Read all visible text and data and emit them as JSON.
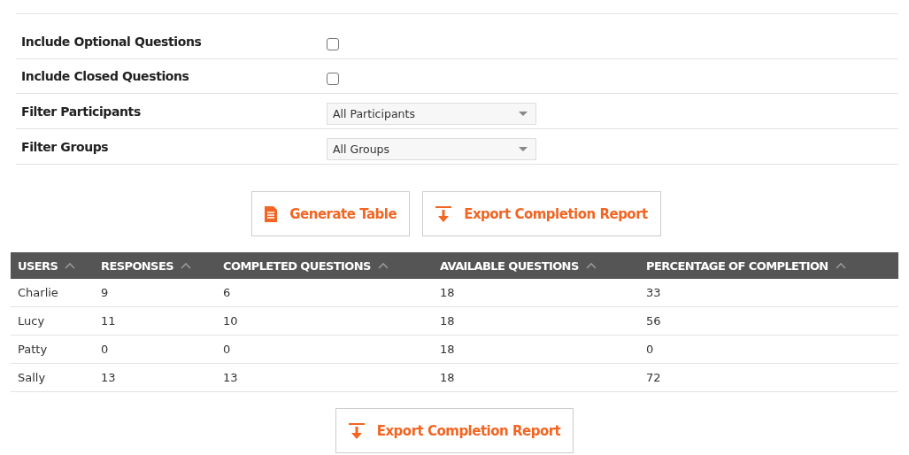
{
  "options": [
    {
      "kind": "checkbox",
      "label": "Include Optional Questions",
      "checked": false
    },
    {
      "kind": "checkbox",
      "label": "Include Closed Questions",
      "checked": false
    },
    {
      "kind": "select",
      "label": "Filter Participants",
      "value": "All Participants"
    },
    {
      "kind": "select",
      "label": "Filter Groups",
      "value": "All Groups"
    }
  ],
  "actions": [
    {
      "kind": "document",
      "label": "Generate Table"
    },
    {
      "kind": "export",
      "label": "Export Completion Report"
    }
  ],
  "table": {
    "columns": [
      "USERS",
      "RESPONSES",
      "COMPLETED QUESTIONS",
      "AVAILABLE QUESTIONS",
      "PERCENTAGE OF COMPLETION"
    ],
    "rows": [
      [
        "Charlie",
        "9",
        "6",
        "18",
        "33"
      ],
      [
        "Lucy",
        "11",
        "10",
        "18",
        "56"
      ],
      [
        "Patty",
        "0",
        "0",
        "18",
        "0"
      ],
      [
        "Sally",
        "13",
        "13",
        "18",
        "72"
      ]
    ]
  },
  "footer_actions": [
    {
      "kind": "export",
      "label": "Export Completion Report"
    }
  ]
}
